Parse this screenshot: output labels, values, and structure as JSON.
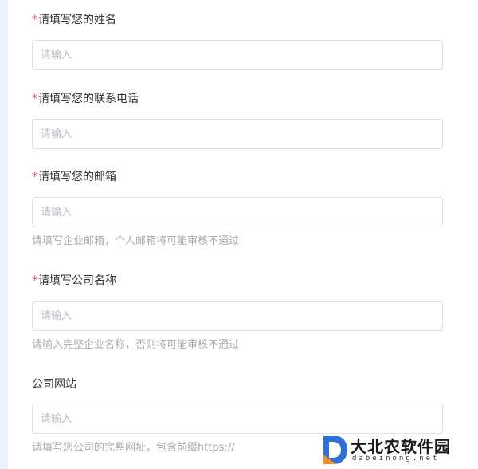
{
  "fields": [
    {
      "label": "请填写您的姓名",
      "required": "*",
      "placeholder": "请输入",
      "value": ""
    },
    {
      "label": "请填写您的联系电话",
      "required": "*",
      "placeholder": "请输入",
      "value": ""
    },
    {
      "label": "请填写您的邮箱",
      "required": "*",
      "placeholder": "请输入",
      "value": "",
      "hint": "请填写企业邮箱，个人邮箱将可能审核不通过"
    },
    {
      "label": "请填写公司名称",
      "required": "*",
      "placeholder": "请输入",
      "value": "",
      "hint": "请输入完整企业名称，否则将可能审核不通过"
    },
    {
      "label": "公司网站",
      "placeholder": "请输入",
      "value": "",
      "hint": "请填写您公司的完整网址，包含前缀https://"
    }
  ],
  "watermark": {
    "title": "大北农软件园",
    "subtitle": "dabeinong.net"
  },
  "colors": {
    "required": "#e5484d",
    "border": "#dcdfe6",
    "hint": "#a8abb2",
    "accent": "#2f6fd6"
  }
}
